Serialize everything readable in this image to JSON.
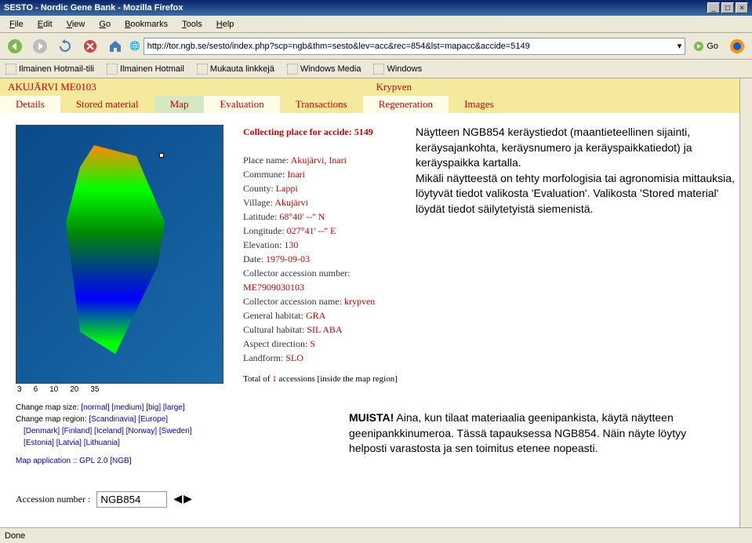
{
  "window": {
    "title": "SESTO - Nordic Gene Bank - Mozilla Firefox",
    "minimize": "_",
    "maximize": "□",
    "close": "×"
  },
  "menubar": {
    "file": "File",
    "edit": "Edit",
    "view": "View",
    "go": "Go",
    "bookmarks": "Bookmarks",
    "tools": "Tools",
    "help": "Help"
  },
  "address": {
    "url": "http://tor.ngb.se/sesto/index.php?scp=ngb&thm=sesto&lev=acc&rec=854&lst=mapacc&accide=5149",
    "go": "Go"
  },
  "bookmarks": {
    "b1": "Ilmainen Hotmail-tili",
    "b2": "Ilmainen Hotmail",
    "b3": "Mukauta linkkejä",
    "b4": "Windows Media",
    "b5": "Windows"
  },
  "header": {
    "accession": "AKUJÄRVI ME0103",
    "name": "Krypven"
  },
  "tabs": {
    "details": "Details",
    "stored": "Stored material",
    "map": "Map",
    "evaluation": "Evaluation",
    "transactions": "Transactions",
    "regeneration": "Regeneration",
    "images": "Images"
  },
  "mapscale": {
    "s1": "3",
    "s2": "6",
    "s3": "10",
    "s4": "20",
    "s5": "35"
  },
  "mapcontrols": {
    "size_label": "Change map size:",
    "normal": "[normal]",
    "medium": "[medium]",
    "big": "[big]",
    "large": "[large]",
    "region_label": "Change map region:",
    "scandinavia": "[Scandinavia]",
    "europe": "[Europe]",
    "denmark": "[Denmark]",
    "finland": "[Finland]",
    "iceland": "[Iceland]",
    "norway": "[Norway]",
    "sweden": "[Sweden]",
    "estonia": "[Estonia]",
    "latvia": "[Latvia]",
    "lithuania": "[Lithuania]"
  },
  "mapapp": "Map application :: GPL 2.0 [NGB]",
  "details": {
    "heading": "Collecting place for accide: 5149",
    "place_label": "Place name:",
    "place_value": "Akujärvi, Inari",
    "commune_label": "Commune:",
    "commune_value": "Inari",
    "county_label": "County:",
    "county_value": "Lappi",
    "village_label": "Village:",
    "village_value": "Akujärvi",
    "lat_label": "Latitude:",
    "lat_value": "68°40' --'' N",
    "lon_label": "Longitude:",
    "lon_value": "027°41' --'' E",
    "elev_label": "Elevation:",
    "elev_value": "130",
    "date_label": "Date:",
    "date_value": "1979-09-03",
    "coll_num_label": "Collector accession number:",
    "coll_num_value": "ME7909030103",
    "coll_name_label": "Collector accession name:",
    "coll_name_value": "krypven",
    "habitat_label": "General habitat:",
    "habitat_value": "GRA",
    "cultural_label": "Cultural habitat:",
    "cultural_value": "SIL ABA",
    "aspect_label": "Aspect direction:",
    "aspect_value": "S",
    "landform_label": "Landform:",
    "landform_value": "SLO"
  },
  "total": {
    "pre": "Total of ",
    "count": "1",
    "post": " accessions [inside the map region]"
  },
  "annotation": {
    "text": "Näytteen NGB854 keräystiedot (maantieteellinen sijainti, keräysajankohta, keräysnumero ja keräyspaikkatiedot) ja keräyspaikka kartalla.\nMikäli näytteestä on tehty morfologisia tai agronomisia mittauksia, löytyvät tiedot valikosta 'Evaluation'. Valikosta 'Stored material' löydät tiedot säilytetyistä siemenistä."
  },
  "note": {
    "muista": "MUISTA!",
    "text": " Aina, kun tilaat materiaalia geenipankista, käytä näytteen geenipankkinumeroa. Tässä tapauksessa NGB854. Näin näyte löytyy helposti varastosta ja sen toimitus etenee nopeasti."
  },
  "acc": {
    "label": "Accession number :",
    "value": "NGB854"
  },
  "status": "Done"
}
